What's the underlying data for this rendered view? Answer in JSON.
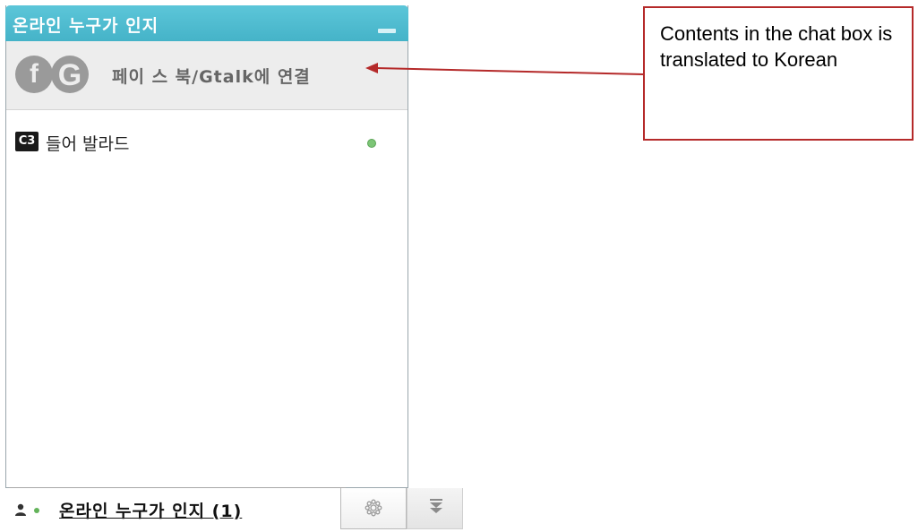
{
  "chat": {
    "title": "온라인 누구가 인지",
    "connect": {
      "facebook_glyph": "f",
      "gtalk_glyph": "G",
      "label": "페이 스 북/Gtalk에 연결"
    },
    "friends": [
      {
        "avatar_text": "C3",
        "name": "들어 발라드",
        "status": "online"
      }
    ],
    "bottom": {
      "online_label": "온라인 누구가 인지 (1)"
    }
  },
  "colors": {
    "header": "#4cbbd0",
    "online": "#7cc576",
    "callout_border": "#b52a2a"
  },
  "annotation": {
    "text": "Contents in the chat box is translated to Korean"
  }
}
